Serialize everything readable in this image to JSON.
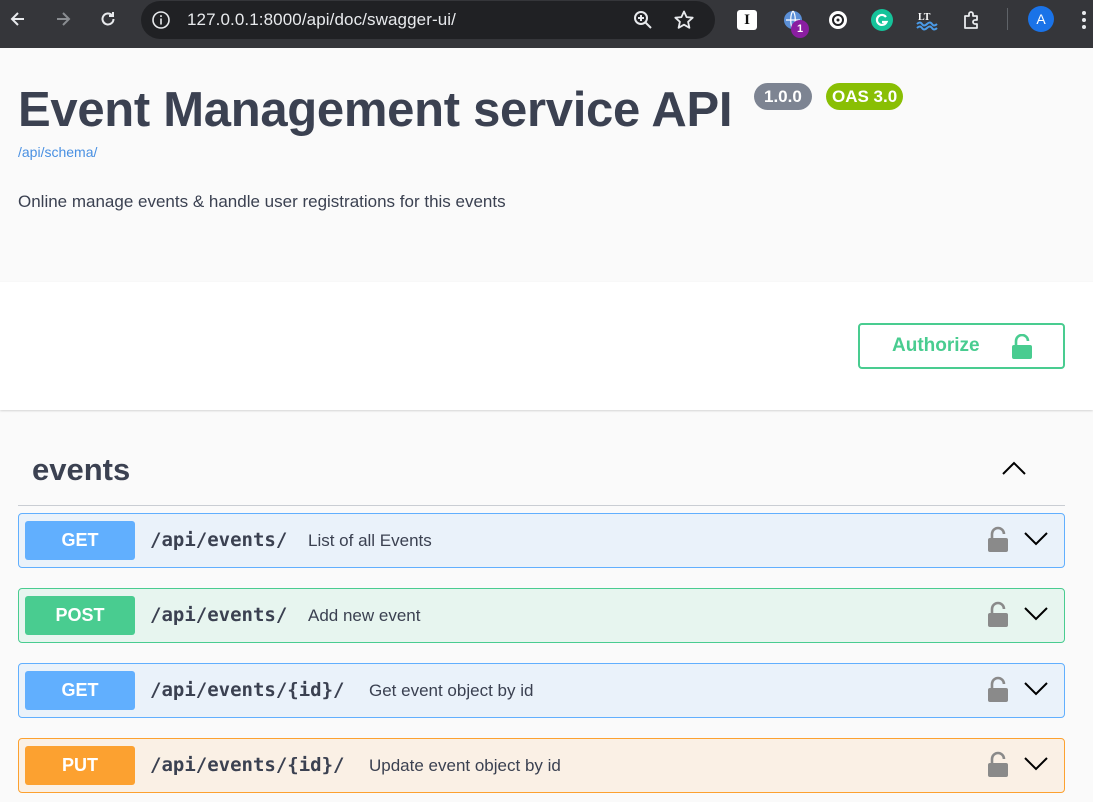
{
  "browser": {
    "url": "127.0.0.1:8000/api/doc/swagger-ui/",
    "extension_badge_count": "1",
    "avatar_initial": "A"
  },
  "info": {
    "title": "Event Management service API",
    "version": "1.0.0",
    "oas": "OAS 3.0",
    "schema_link": "/api/schema/",
    "description": "Online manage events & handle user registrations for this events"
  },
  "auth": {
    "authorize_label": "Authorize"
  },
  "tag": {
    "name": "events"
  },
  "operations": [
    {
      "method": "GET",
      "path": "/api/events/",
      "summary": "List of all Events"
    },
    {
      "method": "POST",
      "path": "/api/events/",
      "summary": "Add new event"
    },
    {
      "method": "GET",
      "path": "/api/events/{id}/",
      "summary": "Get event object by id"
    },
    {
      "method": "PUT",
      "path": "/api/events/{id}/",
      "summary": "Update event object by id"
    }
  ],
  "colors": {
    "get": "#61affe",
    "post": "#49cc90",
    "put": "#fca130",
    "title": "#3b4151",
    "link": "#4990e2"
  }
}
